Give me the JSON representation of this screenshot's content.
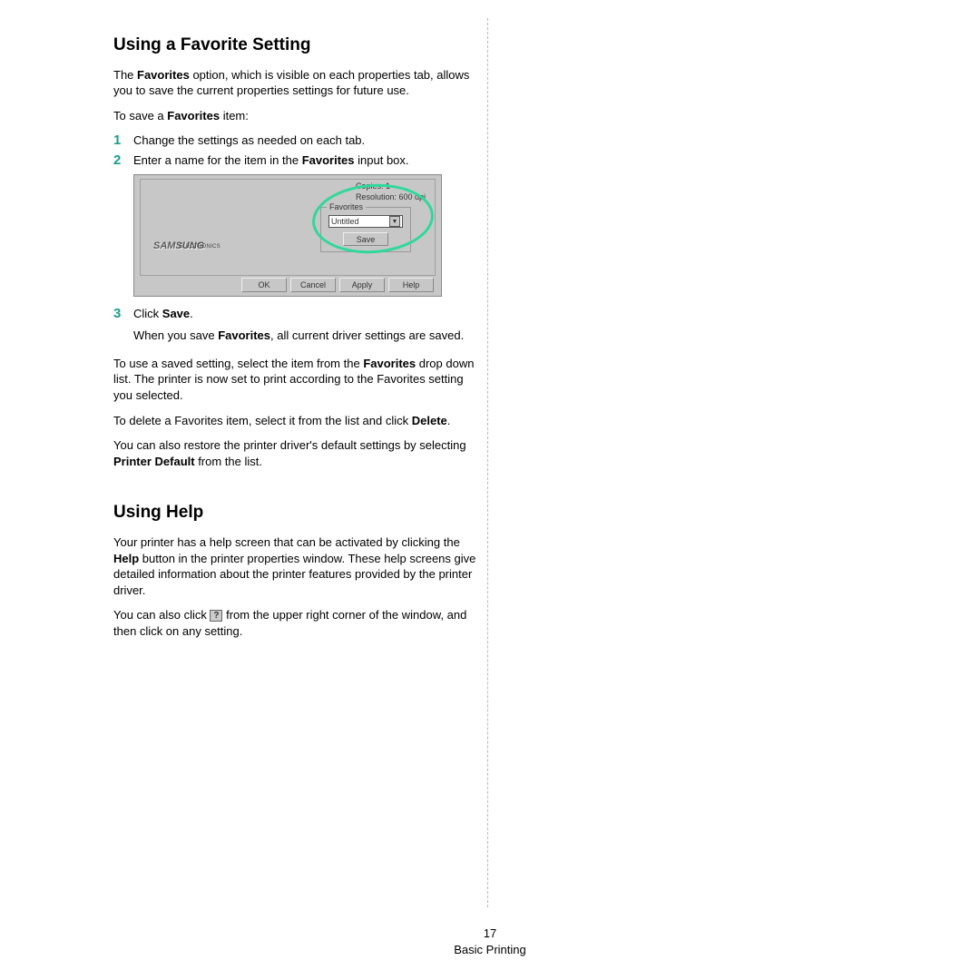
{
  "section1": {
    "heading": "Using a Favorite Setting",
    "intro_pre": "The ",
    "intro_b1": "Favorites",
    "intro_post": " option, which is visible on each properties tab, allows you to save the current properties settings for future use.",
    "save_line_pre": "To save a ",
    "save_line_b": "Favorites",
    "save_line_post": " item:",
    "step1_num": "1",
    "step1_text": "Change the settings as needed on each tab.",
    "step2_num": "2",
    "step2_text_pre": "Enter a name for the item in the ",
    "step2_text_b": "Favorites",
    "step2_text_post": " input box.",
    "step3_num": "3",
    "step3_text_pre": "Click ",
    "step3_text_b": "Save",
    "step3_text_post": ".",
    "step3_sub_pre": "When you save ",
    "step3_sub_b": "Favorites",
    "step3_sub_post": ", all current driver settings are saved.",
    "para_use_pre": "To use a saved setting, select the item from the ",
    "para_use_b": "Favorites",
    "para_use_post": " drop down list. The printer is now set to print according to the Favorites setting you selected.",
    "para_del_pre": "To delete a Favorites item, select it from the list and click ",
    "para_del_b": "Delete",
    "para_del_post": ".",
    "para_restore_pre": "You can also restore the printer driver's default settings by selecting ",
    "para_restore_b": "Printer Default",
    "para_restore_post": " from the list."
  },
  "section2": {
    "heading": "Using Help",
    "para1_pre": "Your printer has a help screen that can be activated by clicking the ",
    "para1_b": "Help",
    "para1_post": " button in the printer properties window. These help screens give detailed information about the printer features provided by the printer driver.",
    "para2_pre": "You can also click ",
    "para2_icon": "?",
    "para2_post": " from the upper right corner of the window, and then click on any setting."
  },
  "screenshot": {
    "copies": "Copies: 1",
    "resolution": "Resolution: 600 dpi",
    "fav_label": "Favorites",
    "combo_value": "Untitled",
    "save_btn": "Save",
    "logo": "SAMSUNG",
    "logo_sub": "ELECTRONICS",
    "ok": "OK",
    "cancel": "Cancel",
    "apply": "Apply",
    "help": "Help"
  },
  "footer": {
    "page_num": "17",
    "section": "Basic Printing"
  }
}
